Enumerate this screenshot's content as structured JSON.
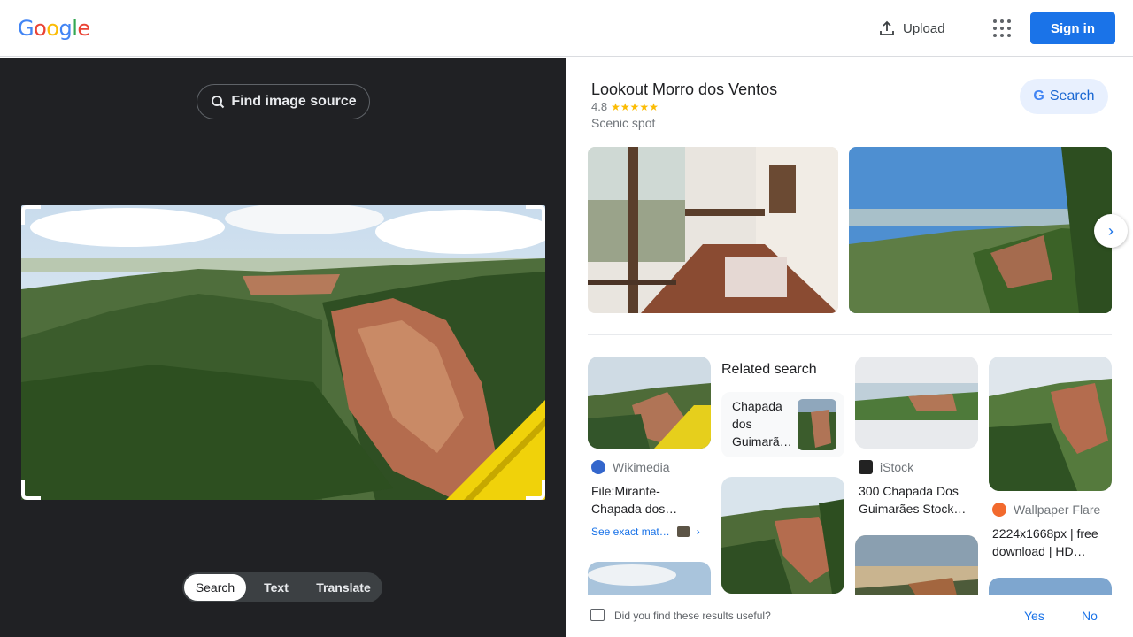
{
  "header": {
    "logo": "Google",
    "logo_colors": [
      "#4285f4",
      "#ea4335",
      "#fbbc05",
      "#4285f4",
      "#34a853",
      "#ea4335"
    ],
    "upload_label": "Upload",
    "signin_label": "Sign in"
  },
  "left": {
    "find_source_label": "Find image source",
    "tabs": [
      {
        "label": "Search",
        "active": true
      },
      {
        "label": "Text",
        "active": false
      },
      {
        "label": "Translate",
        "active": false
      }
    ]
  },
  "place": {
    "title": "Lookout Morro dos Ventos",
    "rating": "4.8",
    "stars": "★★★★★",
    "type": "Scenic spot",
    "search_label": "Search"
  },
  "results": {
    "related_heading": "Related search",
    "related_text": "Chapada dos Guimarã…",
    "cards": [
      {
        "source": "Wikimedia",
        "caption": "File:Mirante-Chapada dos…"
      },
      {
        "source": "iStock",
        "caption": "300 Chapada Dos Guimarães Stock…"
      },
      {
        "source": "Wallpaper Flare",
        "caption": "2224x1668px | free download | HD…"
      }
    ],
    "see_exact": "See exact mat…"
  },
  "feedback": {
    "question": "Did you find these results useful?",
    "yes": "Yes",
    "no": "No"
  },
  "colors": {
    "accent": "#1a73e8",
    "dark_panel": "#202124"
  }
}
